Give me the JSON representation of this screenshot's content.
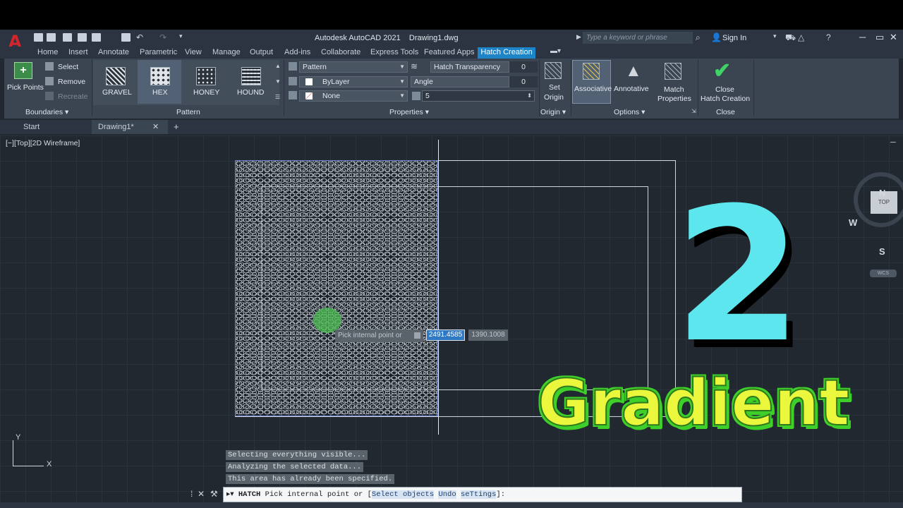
{
  "app": {
    "title": "Autodesk AutoCAD 2021    Drawing1.dwg",
    "search_placeholder": "Type a keyword or phrase",
    "sign_in": "Sign In"
  },
  "tabs": [
    "Home",
    "Insert",
    "Annotate",
    "Parametric",
    "View",
    "Manage",
    "Output",
    "Add-ins",
    "Collaborate",
    "Express Tools",
    "Featured Apps"
  ],
  "active_tab": "Hatch Creation",
  "ribbon": {
    "boundaries": {
      "pick_points": "Pick Points",
      "select": "Select",
      "remove": "Remove",
      "recreate": "Recreate",
      "label": "Boundaries ▾"
    },
    "pattern": {
      "items": [
        "GRAVEL",
        "HEX",
        "HONEY",
        "HOUND"
      ],
      "label": "Pattern"
    },
    "properties": {
      "type": "Pattern",
      "color": "ByLayer",
      "background": "None",
      "transparency_label": "Hatch Transparency",
      "transparency_value": "0",
      "angle_label": "Angle",
      "angle_value": "0",
      "scale_value": "5",
      "label": "Properties ▾"
    },
    "origin": {
      "set_origin_1": "Set",
      "set_origin_2": "Origin",
      "label": "Origin ▾"
    },
    "options": {
      "associative": "Associative",
      "annotative": "Annotative",
      "match_1": "Match",
      "match_2": "Properties",
      "label": "Options ▾"
    },
    "close": {
      "close_1": "Close",
      "close_2": "Hatch Creation",
      "label": "Close"
    }
  },
  "file_tabs": {
    "start": "Start",
    "drawing": "Drawing1*",
    "close": "✕",
    "add": "+"
  },
  "viewport": {
    "label": "[−][Top][2D Wireframe]",
    "tooltip": "Pick internal point or",
    "coord_x": "2491.4585",
    "coord_y": "1390.1008"
  },
  "viewcube": {
    "north": "N",
    "south": "S",
    "west": "W",
    "top": "TOP",
    "wcs": "WCS"
  },
  "overlay": {
    "number": "2",
    "word": "Gradient"
  },
  "command": {
    "history": [
      "Selecting everything visible...",
      "Analyzing the selected data...",
      "This area has already been specified."
    ],
    "cmd": "HATCH",
    "prompt": "Pick internal point or [",
    "opt_select": "Select objects",
    "opt_undo": "Undo",
    "opt_settings": "seTtings",
    "suffix": "]:"
  },
  "ucs": {
    "x": "X",
    "y": "Y"
  },
  "colors": {
    "accent": "#1e84c8",
    "hatch_boundary": "#6f86d6",
    "overlay_cyan": "#5de6ee",
    "overlay_yellow": "#eaf73c",
    "overlay_green": "#3ecf2a"
  }
}
